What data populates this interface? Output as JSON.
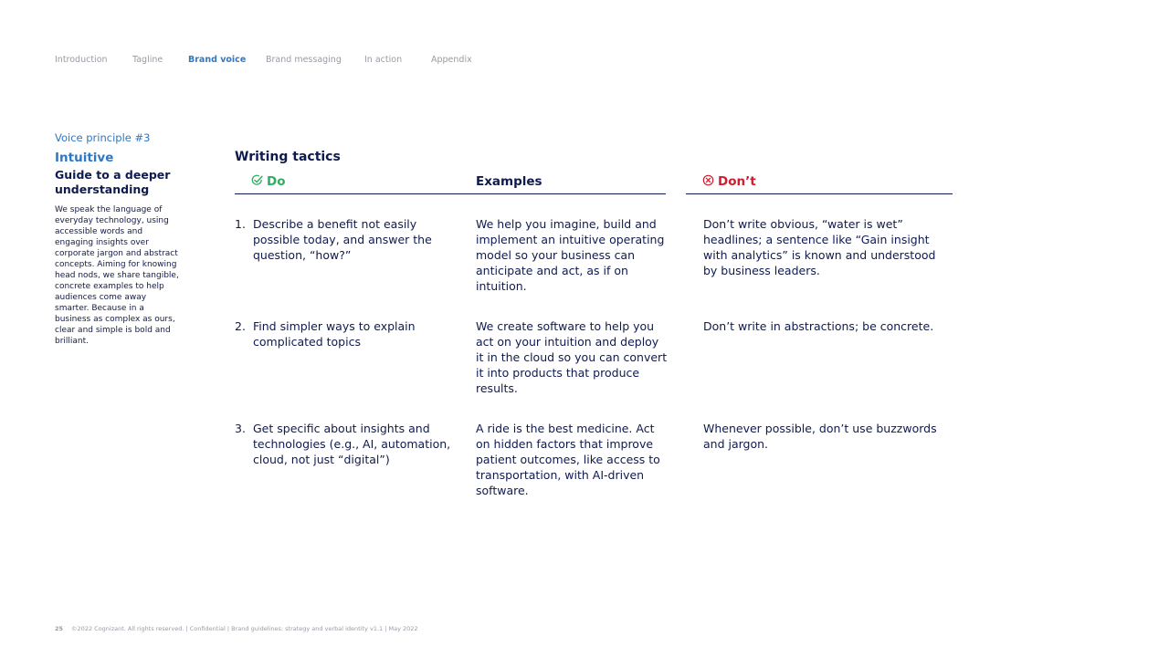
{
  "nav": {
    "items": [
      "Introduction",
      "Tagline",
      "Brand voice",
      "Brand messaging",
      "In action",
      "Appendix"
    ],
    "active": "Brand voice"
  },
  "side": {
    "kicker": "Voice principle #3",
    "title": "Intuitive",
    "subtitle": "Guide to a deeper understanding",
    "body": "We speak the language of everyday technology, using accessible words and engaging insights over corporate jargon and abstract concepts. Aiming for knowing head nods, we share tangible, concrete examples to help audiences come away smarter. Because in a business as complex as ours, clear and simple is bold and brilliant."
  },
  "main": {
    "title": "Writing tactics",
    "headers": {
      "do": "Do",
      "examples": "Examples",
      "dont": "Don’t"
    },
    "rows": [
      {
        "num": "1.",
        "do": "Describe a benefit not easily possible today, and answer the question, “how?”",
        "example": "We help you imagine, build and implement an intuitive operating model so your business can anticipate and act, as if on intuition.",
        "dont": "Don’t write obvious, “water is wet” headlines; a sentence like “Gain insight with analytics” is known and understood by business leaders."
      },
      {
        "num": "2.",
        "do": "Find simpler ways to explain complicated topics",
        "example": "We create software to help you act on your intuition and deploy it in the cloud so you can convert it into products that produce results.",
        "dont": "Don’t write in abstractions; be concrete."
      },
      {
        "num": "3.",
        "do": "Get specific about insights and technologies (e.g., AI, automation, cloud, not just “digital”)",
        "example": "A ride is the best medicine. Act on hidden factors that improve patient outcomes, like access to transportation, with AI-driven software.",
        "dont": "Whenever possible, don’t use buzzwords and jargon."
      }
    ]
  },
  "footer": {
    "page": "25",
    "text": "©2022 Cognizant. All rights reserved.  |  Confidential  |  Brand guidelines: strategy and verbal identity v1.1  |  May 2022"
  },
  "colors": {
    "accent": "#2f78c4",
    "navy": "#0f1a4f",
    "do": "#2eae62",
    "dont": "#d01d2f",
    "muted": "#9a9aa6"
  }
}
